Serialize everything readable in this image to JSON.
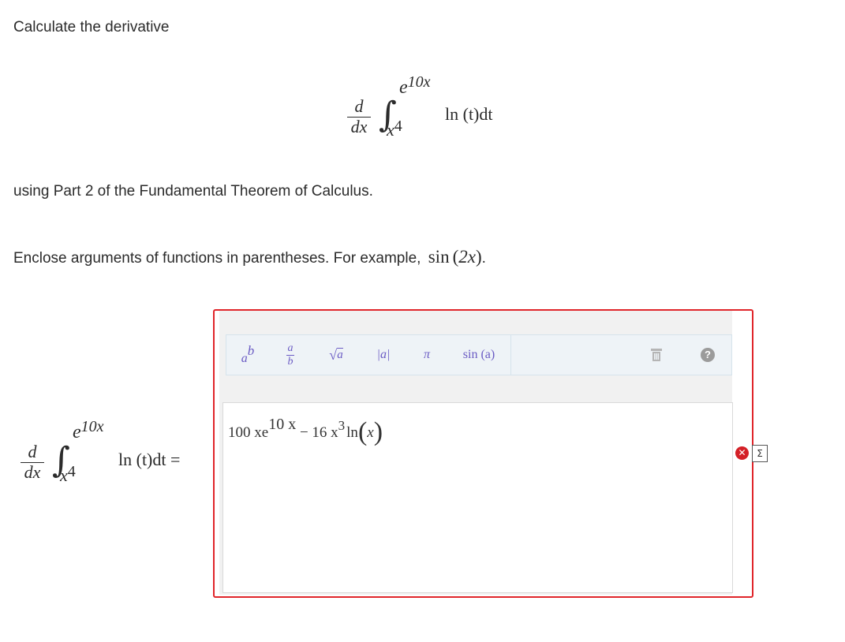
{
  "intro": "Calculate the derivative",
  "part2_text": "using Part 2 of the Fundamental Theorem of Calculus.",
  "instruction": "Enclose arguments of functions in parentheses. For example,",
  "example": {
    "fn": "sin",
    "open": "(",
    "arg": "2x",
    "close": ")",
    "period": "."
  },
  "formula": {
    "d": "d",
    "dx": "dx",
    "integral": "∫",
    "upper": "e",
    "upper_exp": "10x",
    "lower": "x",
    "lower_exp": "4",
    "integrand": "ln (t)dt"
  },
  "answer_prefix": {
    "integrand": "ln (t)dt ="
  },
  "toolbar": {
    "power_base": "a",
    "power_exp": "b",
    "frac_num": "a",
    "frac_den": "b",
    "sqrt": "√",
    "sqrt_arg": "a",
    "abs": "|a|",
    "pi": "π",
    "sin": "sin (a)",
    "trash_icon": "trash-icon",
    "help_icon": "question-icon",
    "help": "?"
  },
  "answer": {
    "part1": "100 xe",
    "exp1": "10 x",
    "part2": "− 16 x",
    "exp2": "3",
    "part3": "ln",
    "arg": "x"
  },
  "status": {
    "wrong": "✕",
    "sigma": "Σ"
  },
  "colors": {
    "error_border": "#e0252a",
    "toolbar_accent": "#6b5cc4"
  }
}
